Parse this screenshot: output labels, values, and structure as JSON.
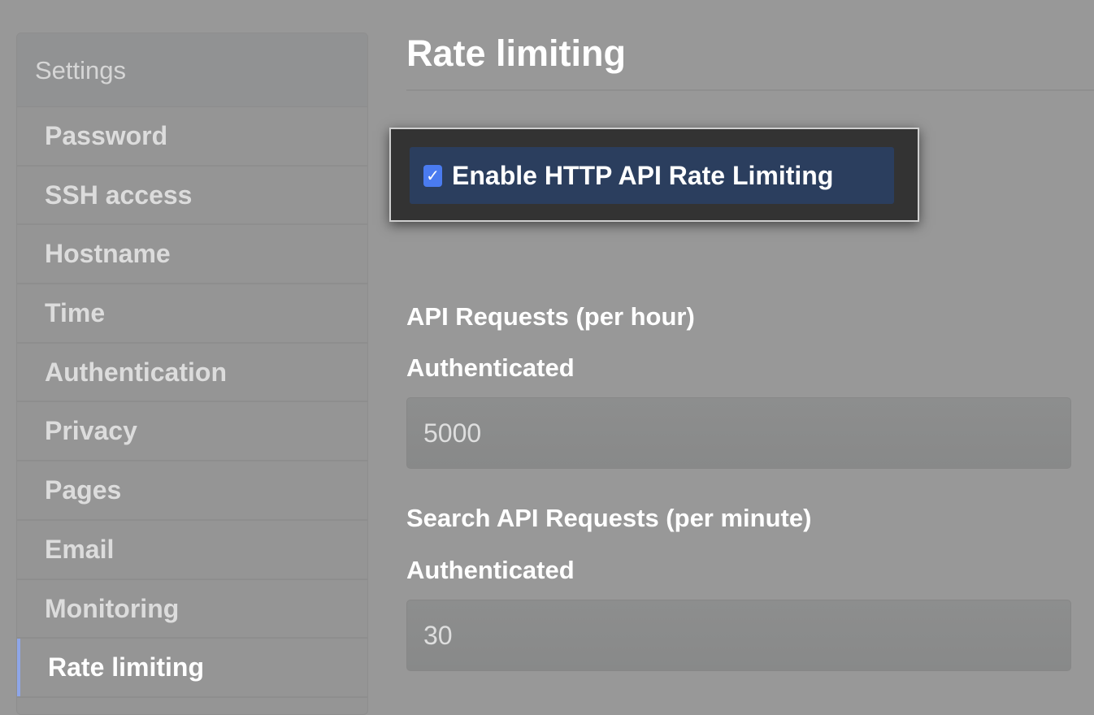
{
  "sidebar": {
    "header": "Settings",
    "items": [
      {
        "label": "Password"
      },
      {
        "label": "SSH access"
      },
      {
        "label": "Hostname"
      },
      {
        "label": "Time"
      },
      {
        "label": "Authentication"
      },
      {
        "label": "Privacy"
      },
      {
        "label": "Pages"
      },
      {
        "label": "Email"
      },
      {
        "label": "Monitoring"
      },
      {
        "label": "Rate limiting",
        "active": true
      }
    ]
  },
  "main": {
    "title": "Rate limiting",
    "enable_checkbox": {
      "label": "Enable HTTP API Rate Limiting",
      "checked": true,
      "icon": "checkmark-icon"
    },
    "api_requests": {
      "section_title": "API Requests (per hour)",
      "field_label": "Authenticated",
      "value": "5000"
    },
    "search_api_requests": {
      "section_title": "Search API Requests (per minute)",
      "field_label": "Authenticated",
      "value": "30"
    }
  },
  "colors": {
    "accent": "#8ea6e8",
    "checkbox": "#4a7bf0",
    "highlight_row": "#2b3e5e",
    "highlight_frame": "#333333"
  }
}
